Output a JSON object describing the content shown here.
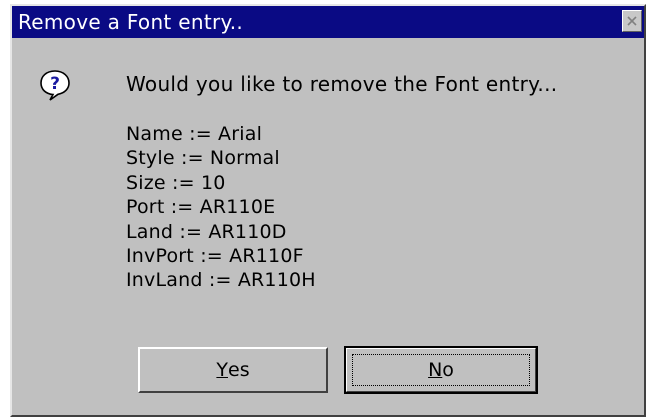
{
  "window": {
    "title": "Remove a Font entry..",
    "close_glyph": "×"
  },
  "icon": {
    "name": "question-icon",
    "glyph": "?"
  },
  "message": "Would you like to remove the Font entry...",
  "details": [
    "Name  := Arial",
    "Style := Normal",
    "Size  := 10",
    "Port  := AR110E",
    "Land  := AR110D",
    "InvPort := AR110F",
    "InvLand := AR110H"
  ],
  "buttons": {
    "yes": {
      "mnemonic": "Y",
      "rest": "es"
    },
    "no": {
      "mnemonic": "N",
      "rest": "o"
    }
  },
  "colors": {
    "titlebar": "#0a0a84",
    "dialog_face": "#c0c0c0",
    "icon_fill": "#1a1aa0"
  }
}
